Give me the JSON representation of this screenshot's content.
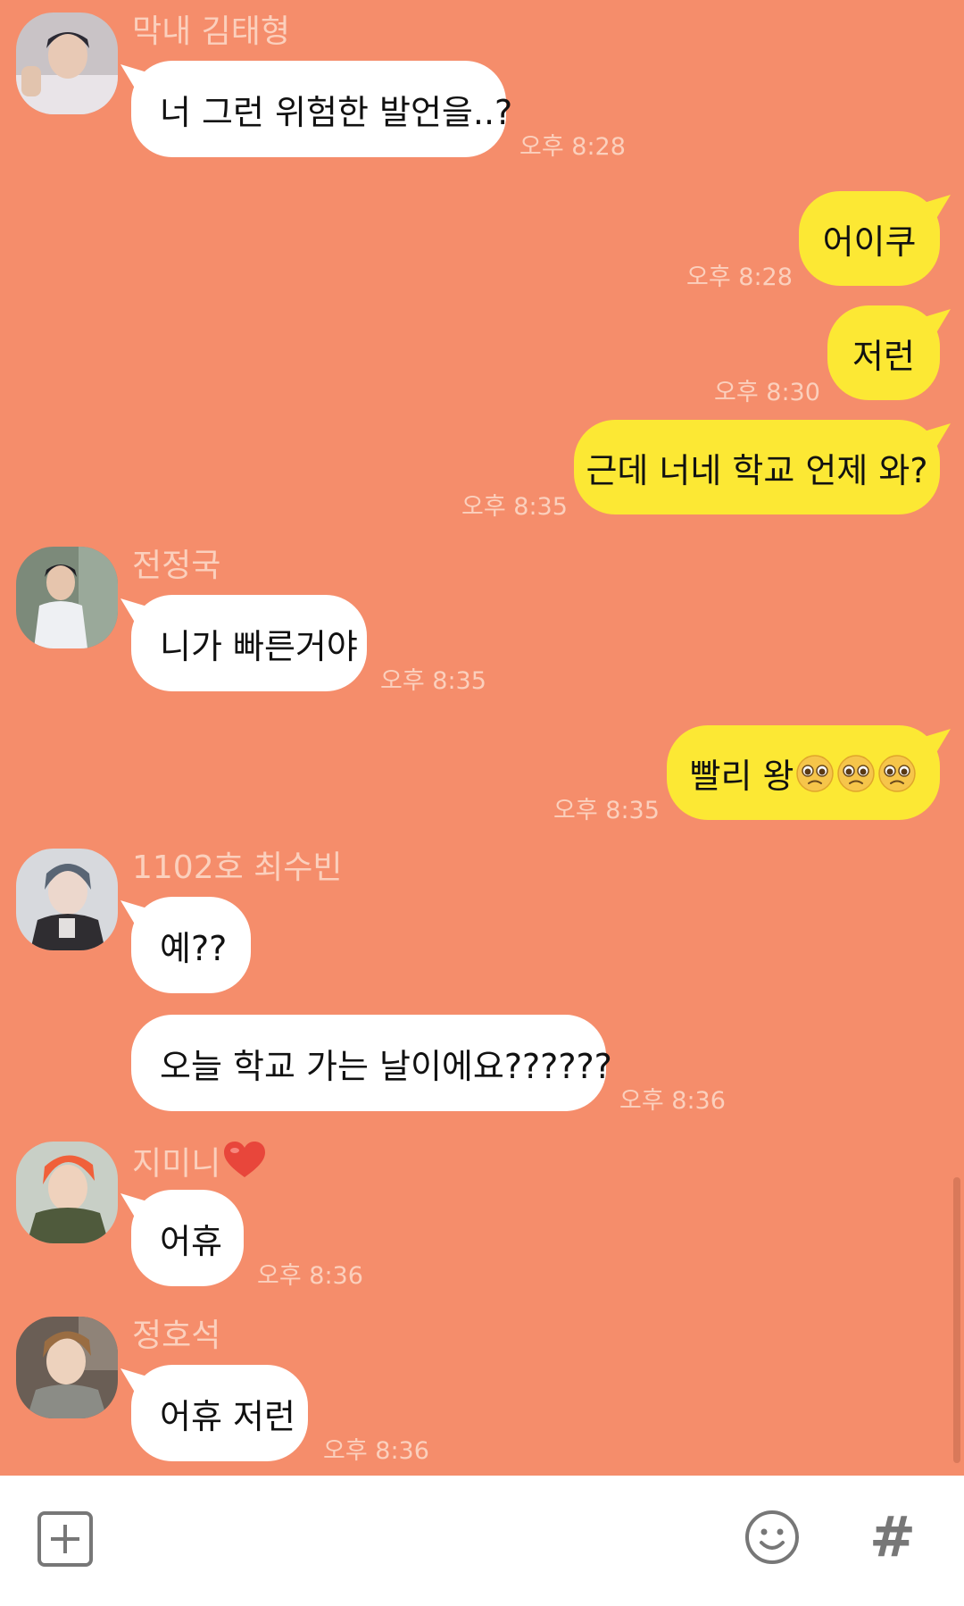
{
  "colors": {
    "background": "#f58d6b",
    "incoming_bubble": "#ffffff",
    "outgoing_bubble": "#fce834",
    "meta_text": "#fbd0bd"
  },
  "messages": {
    "m1": {
      "sender": "막내 김태형",
      "text": "너 그런 위험한 발언을..?",
      "time": "오후 8:28"
    },
    "m2": {
      "text": "어이쿠",
      "time": "오후 8:28"
    },
    "m3": {
      "text": "저런",
      "time": "오후 8:30"
    },
    "m4": {
      "text": "근데 너네 학교 언제 와?",
      "time": "오후 8:35"
    },
    "m5": {
      "sender": "전정국",
      "text": "니가 빠른거야",
      "time": "오후 8:35"
    },
    "m6": {
      "text": "빨리 왕",
      "emoji": "pleading-face-emoji",
      "emoji_count": 3,
      "time": "오후 8:35"
    },
    "m7": {
      "sender": "1102호 최수빈",
      "text": "예??"
    },
    "m8": {
      "text": "오늘 학교 가는 날이에요??????",
      "time": "오후 8:36"
    },
    "m9": {
      "sender": "지미니",
      "sender_icon": "red-heart-emoji",
      "text": "어휴",
      "time": "오후 8:36"
    },
    "m10": {
      "sender": "정호석",
      "text": "어휴 저런",
      "time": "오후 8:36"
    }
  },
  "input_bar": {
    "left_icon": "plus-square-icon",
    "emoji_icon": "smiley-icon",
    "hashtag_icon": "hashtag-icon",
    "hashtag_symbol": "#"
  }
}
